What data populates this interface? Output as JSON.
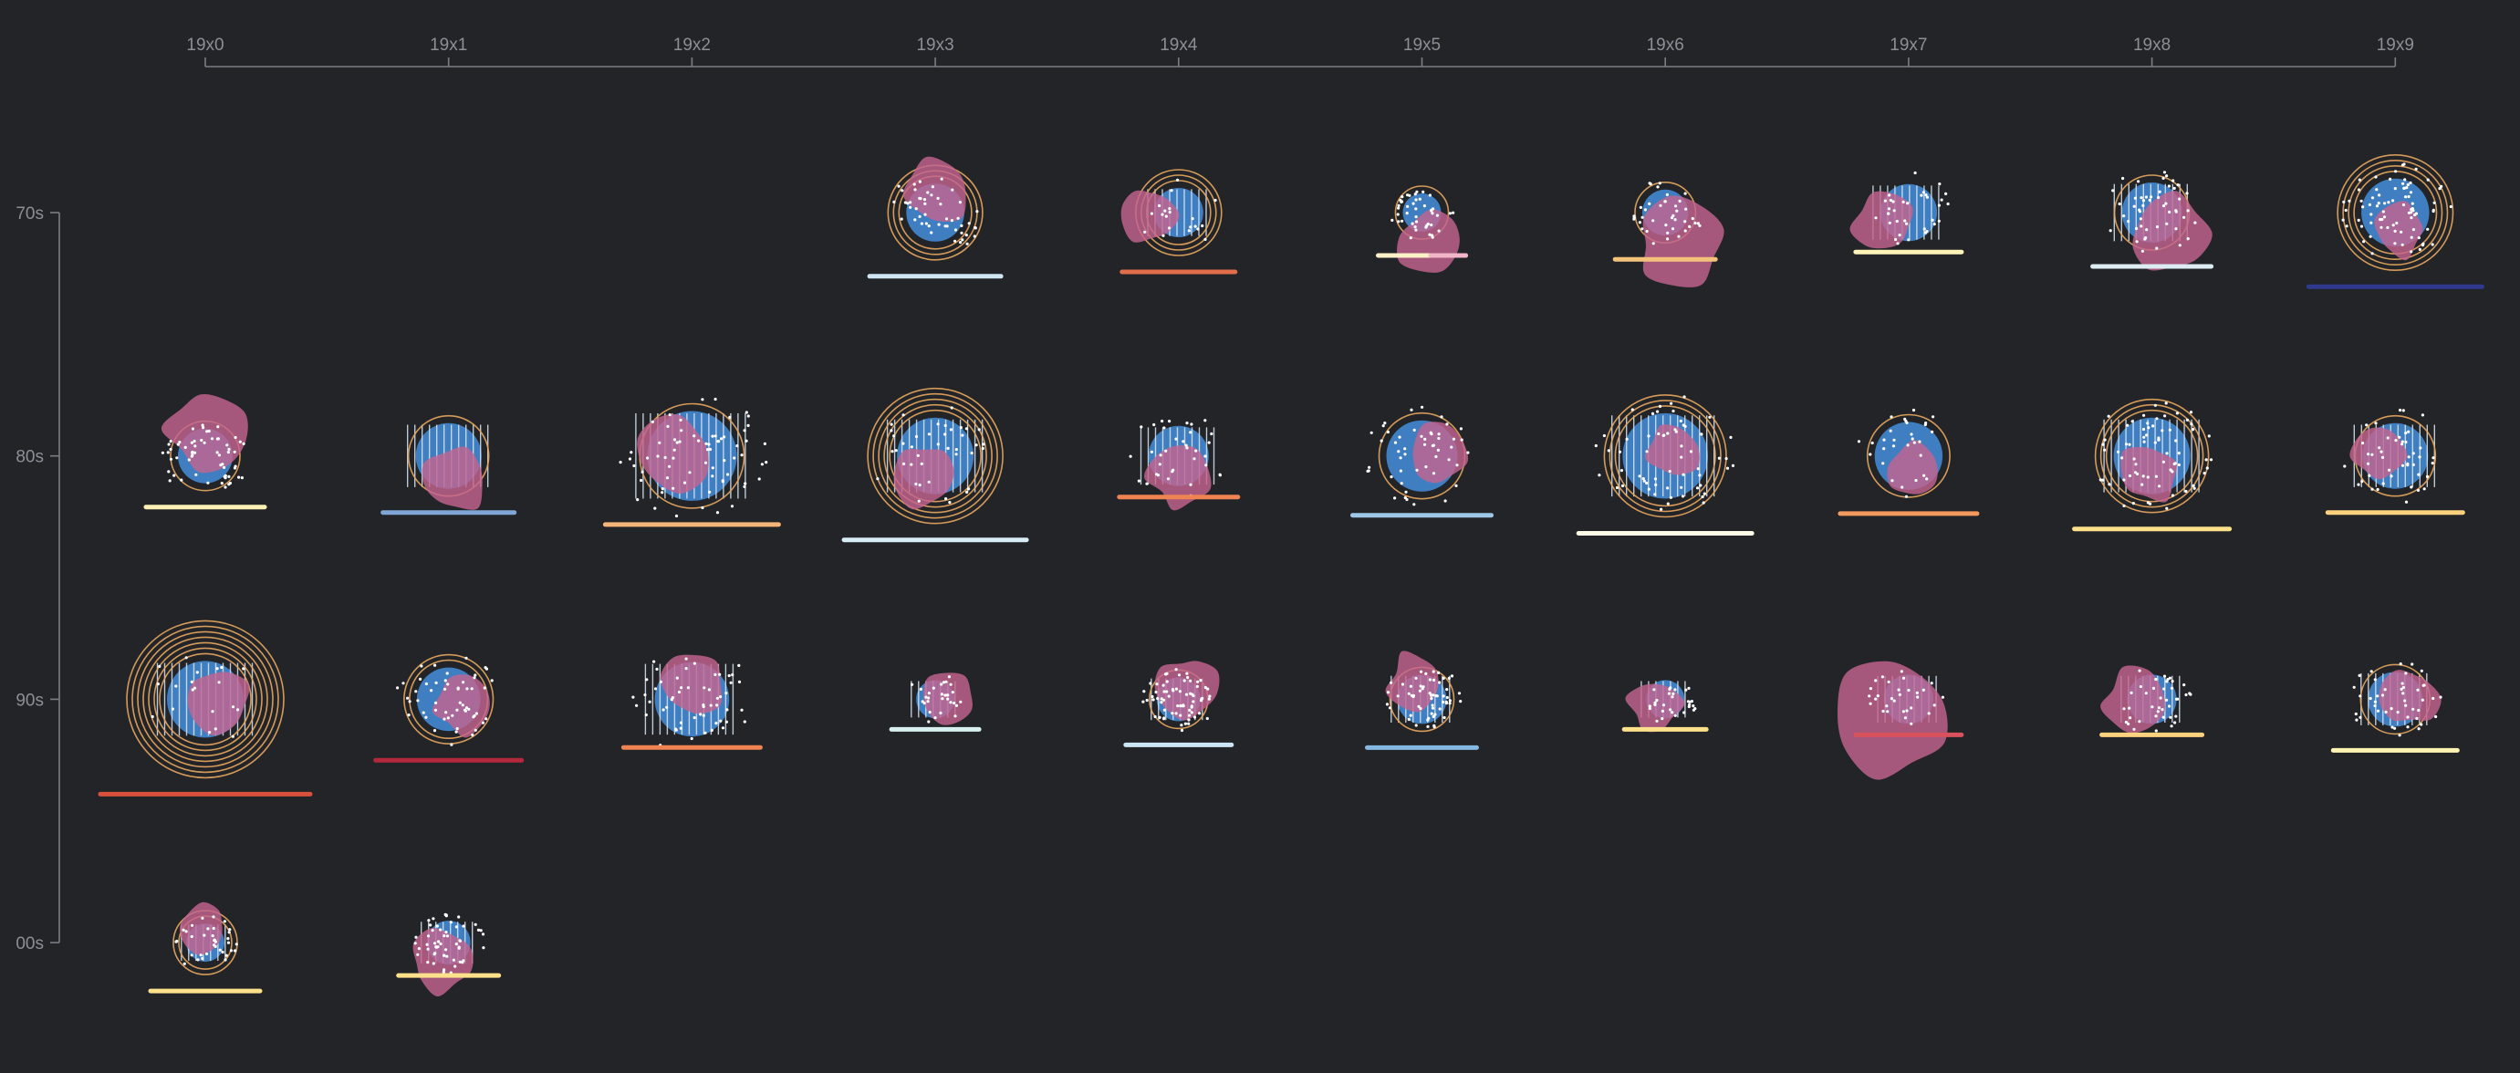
{
  "x_axis": {
    "ticks": [
      "19x0",
      "19x1",
      "19x2",
      "19x3",
      "19x4",
      "19x5",
      "19x6",
      "19x7",
      "19x8",
      "19x9"
    ]
  },
  "y_axis": {
    "ticks": [
      "70s",
      "80s",
      "90s",
      "00s"
    ]
  },
  "colors": {
    "background": "#222428",
    "disc": "#3f7fc1",
    "blob": "#c2648f",
    "rings": "#e8a75e",
    "stripes": "#d9e6f2",
    "dots": "#ffffff"
  },
  "glyphs": [
    {
      "year": "1973",
      "row": 0,
      "col": 3,
      "circle": 0.53,
      "blob": 0.62,
      "rings": 3,
      "stripes": 0,
      "dots": 50,
      "bar": 0.72,
      "bar_color": "#cfe6f2",
      "blob_dx": 0.05,
      "blob_dy": -0.42,
      "angle": 10
    },
    {
      "year": "1974",
      "row": 0,
      "col": 4,
      "circle": 0.45,
      "blob": 0.55,
      "rings": 3,
      "stripes": 1,
      "dots": 20,
      "bar": 0.62,
      "bar_color": "#e16d4a",
      "blob_dx": -0.55,
      "blob_dy": 0.05,
      "angle": 40
    },
    {
      "year": "1975",
      "row": 0,
      "col": 5,
      "circle": 0.35,
      "blob": 0.62,
      "rings": 1,
      "stripes": 0,
      "dots": 45,
      "bar": 0.48,
      "bar_color": "#fff1c7",
      "bar2_color": "#f2b6c8",
      "blob_dx": 0.18,
      "blob_dy": 0.55,
      "angle": 70
    },
    {
      "year": "1976",
      "row": 0,
      "col": 6,
      "circle": 0.42,
      "blob": 0.8,
      "rings": 1,
      "stripes": 0,
      "dots": 40,
      "bar": 0.55,
      "bar_color": "#f5c27b",
      "blob_dx": 0.25,
      "blob_dy": 0.6,
      "angle": 100
    },
    {
      "year": "1977",
      "row": 0,
      "col": 7,
      "circle": 0.52,
      "blob": 0.55,
      "rings": 0,
      "stripes": 1,
      "dots": 35,
      "bar": 0.58,
      "bar_color": "#fff3b8",
      "blob_dx": -0.45,
      "blob_dy": 0.2,
      "angle": 130
    },
    {
      "year": "1978",
      "row": 0,
      "col": 8,
      "circle": 0.55,
      "blob": 0.7,
      "rings": 1,
      "stripes": 1,
      "dots": 50,
      "bar": 0.65,
      "bar_color": "#dcecf2",
      "blob_dx": 0.3,
      "blob_dy": 0.4,
      "angle": 160
    },
    {
      "year": "1979",
      "row": 0,
      "col": 9,
      "circle": 0.62,
      "blob": 0.5,
      "rings": 4,
      "stripes": 0,
      "dots": 80,
      "bar": 0.95,
      "bar_color": "#2f3a8f",
      "blob_dx": 0.1,
      "blob_dy": 0.3,
      "angle": 200
    },
    {
      "year": "1980",
      "row": 1,
      "col": 0,
      "circle": 0.5,
      "blob": 0.72,
      "rings": 1,
      "stripes": 0,
      "dots": 60,
      "bar": 0.65,
      "bar_color": "#fbf1b4",
      "blob_dx": 0.02,
      "blob_dy": -0.5,
      "angle": 20
    },
    {
      "year": "1981",
      "row": 1,
      "col": 1,
      "circle": 0.6,
      "blob": 0.62,
      "rings": 1,
      "stripes": 1,
      "dots": 0,
      "bar": 0.72,
      "bar_color": "#7fa6d6",
      "blob_dx": 0.1,
      "blob_dy": 0.45,
      "angle": 50
    },
    {
      "year": "1982",
      "row": 1,
      "col": 2,
      "circle": 0.82,
      "blob": 0.72,
      "rings": 1,
      "stripes": 1,
      "dots": 70,
      "bar": 0.95,
      "bar_color": "#f5b579",
      "blob_dx": -0.35,
      "blob_dy": -0.1,
      "angle": 80
    },
    {
      "year": "1983",
      "row": 1,
      "col": 3,
      "circle": 0.7,
      "blob": 0.58,
      "rings": 5,
      "stripes": 1,
      "dots": 40,
      "bar": 1.0,
      "bar_color": "#d8ecf5",
      "blob_dx": -0.2,
      "blob_dy": 0.35,
      "angle": 110
    },
    {
      "year": "1984",
      "row": 1,
      "col": 4,
      "circle": 0.55,
      "blob": 0.55,
      "rings": 0,
      "stripes": 1,
      "dots": 35,
      "bar": 0.65,
      "bar_color": "#ef8352",
      "blob_dx": 0.0,
      "blob_dy": 0.4,
      "angle": 140
    },
    {
      "year": "1985",
      "row": 1,
      "col": 5,
      "circle": 0.65,
      "blob": 0.55,
      "rings": 1,
      "stripes": 0,
      "dots": 50,
      "bar": 0.76,
      "bar_color": "#9ec7e8",
      "blob_dx": 0.25,
      "blob_dy": 0.0,
      "angle": 170
    },
    {
      "year": "1986",
      "row": 1,
      "col": 6,
      "circle": 0.78,
      "blob": 0.5,
      "rings": 3,
      "stripes": 1,
      "dots": 60,
      "bar": 0.95,
      "bar_color": "#fbfbe8",
      "blob_dx": 0.15,
      "blob_dy": -0.15,
      "angle": 200
    },
    {
      "year": "1987",
      "row": 1,
      "col": 7,
      "circle": 0.62,
      "blob": 0.55,
      "rings": 1,
      "stripes": 0,
      "dots": 30,
      "bar": 0.75,
      "bar_color": "#f49a5d",
      "blob_dx": 0.1,
      "blob_dy": 0.3,
      "angle": 230
    },
    {
      "year": "1988",
      "row": 1,
      "col": 8,
      "circle": 0.7,
      "blob": 0.55,
      "rings": 3,
      "stripes": 1,
      "dots": 70,
      "bar": 0.85,
      "bar_color": "#fde08a",
      "blob_dx": -0.05,
      "blob_dy": 0.3,
      "angle": 260
    },
    {
      "year": "1989",
      "row": 1,
      "col": 9,
      "circle": 0.6,
      "blob": 0.5,
      "rings": 1,
      "stripes": 1,
      "dots": 45,
      "bar": 0.74,
      "bar_color": "#fdd27f",
      "blob_dx": -0.3,
      "blob_dy": -0.08,
      "angle": 290
    },
    {
      "year": "1990",
      "row": 2,
      "col": 0,
      "circle": 0.7,
      "blob": 0.58,
      "rings": 7,
      "stripes": 1,
      "dots": 20,
      "bar": 1.15,
      "bar_color": "#d9513c",
      "blob_dx": 0.2,
      "blob_dy": 0.0,
      "angle": 15
    },
    {
      "year": "1991",
      "row": 2,
      "col": 1,
      "circle": 0.58,
      "blob": 0.55,
      "rings": 2,
      "stripes": 0,
      "dots": 55,
      "bar": 0.8,
      "bar_color": "#b4283c",
      "blob_dx": 0.25,
      "blob_dy": 0.08,
      "angle": 45
    },
    {
      "year": "1992",
      "row": 2,
      "col": 2,
      "circle": 0.68,
      "blob": 0.55,
      "rings": 0,
      "stripes": 1,
      "dots": 55,
      "bar": 0.75,
      "bar_color": "#ef8352",
      "blob_dx": 0.0,
      "blob_dy": -0.25,
      "angle": 75
    },
    {
      "year": "1993",
      "row": 2,
      "col": 3,
      "circle": 0.35,
      "blob": 0.48,
      "rings": 0,
      "stripes": 1,
      "dots": 30,
      "bar": 0.48,
      "bar_color": "#d8f0f0",
      "blob_dx": 0.25,
      "blob_dy": 0.0,
      "angle": 105
    },
    {
      "year": "1994",
      "row": 2,
      "col": 4,
      "circle": 0.4,
      "blob": 0.55,
      "rings": 1,
      "stripes": 1,
      "dots": 70,
      "bar": 0.58,
      "bar_color": "#cde6f5",
      "blob_dx": 0.15,
      "blob_dy": -0.25,
      "angle": 135
    },
    {
      "year": "1995",
      "row": 2,
      "col": 5,
      "circle": 0.45,
      "blob": 0.55,
      "rings": 1,
      "stripes": 1,
      "dots": 60,
      "bar": 0.6,
      "bar_color": "#86b8e4",
      "blob_dx": -0.1,
      "blob_dy": -0.3,
      "angle": 165
    },
    {
      "year": "1996",
      "row": 2,
      "col": 6,
      "circle": 0.35,
      "blob": 0.5,
      "rings": 0,
      "stripes": 1,
      "dots": 30,
      "bar": 0.45,
      "bar_color": "#fde08a",
      "blob_dx": -0.2,
      "blob_dy": 0.12,
      "angle": 195
    },
    {
      "year": "1997",
      "row": 2,
      "col": 7,
      "circle": 0.45,
      "blob": 1.05,
      "rings": 0,
      "stripes": 1,
      "dots": 30,
      "bar": 0.58,
      "bar_color": "#d9515c",
      "blob_dx": -0.3,
      "blob_dy": 0.35,
      "angle": 225
    },
    {
      "year": "1998",
      "row": 2,
      "col": 8,
      "circle": 0.45,
      "blob": 0.6,
      "rings": 0,
      "stripes": 1,
      "dots": 40,
      "bar": 0.55,
      "bar_color": "#fdd27f",
      "blob_dx": -0.35,
      "blob_dy": 0.08,
      "angle": 255
    },
    {
      "year": "1999",
      "row": 2,
      "col": 9,
      "circle": 0.5,
      "blob": 0.55,
      "rings": 1,
      "stripes": 1,
      "dots": 45,
      "bar": 0.68,
      "bar_color": "#fef3b0",
      "blob_dx": 0.25,
      "blob_dy": -0.05,
      "angle": 285
    },
    {
      "year": "2000",
      "row": 3,
      "col": 0,
      "circle": 0.35,
      "blob": 0.42,
      "rings": 2,
      "stripes": 1,
      "dots": 35,
      "bar": 0.6,
      "bar_color": "#fde08a",
      "blob_dx": 0.0,
      "blob_dy": -0.25,
      "angle": 25
    },
    {
      "year": "2001",
      "row": 3,
      "col": 1,
      "circle": 0.4,
      "blob": 0.6,
      "rings": 0,
      "stripes": 1,
      "dots": 55,
      "bar": 0.55,
      "bar_color": "#fde08a",
      "blob_dx": -0.15,
      "blob_dy": 0.35,
      "angle": 55
    }
  ]
}
